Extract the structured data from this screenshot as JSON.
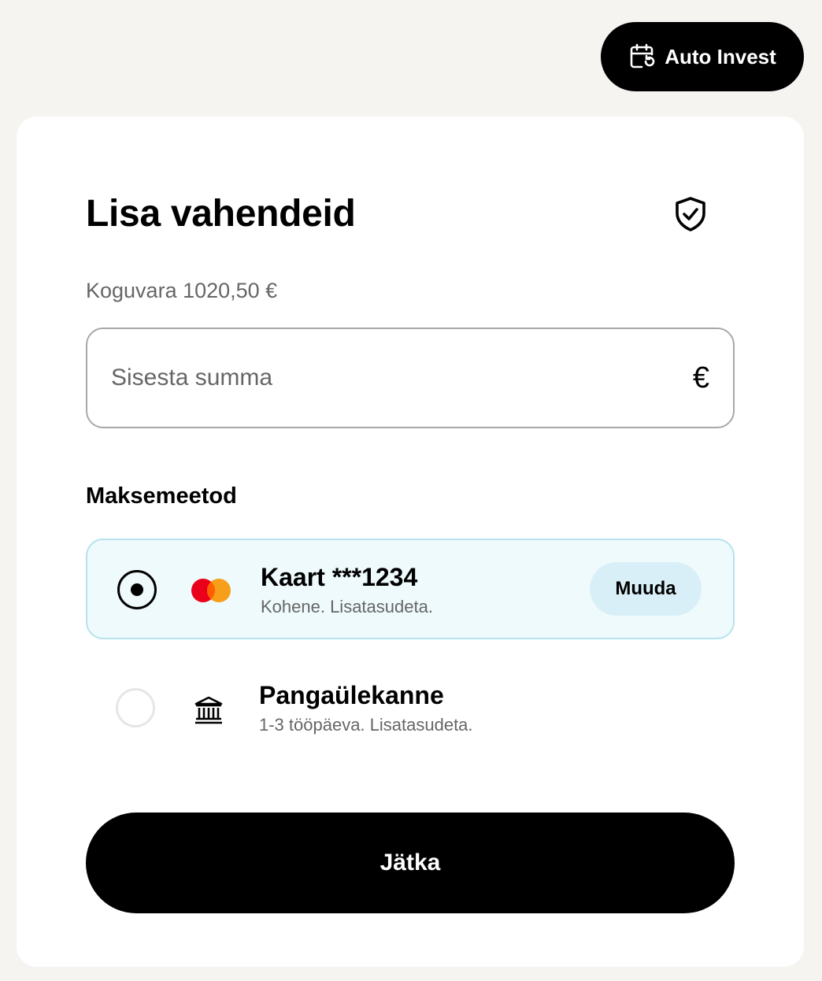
{
  "header": {
    "auto_invest_label": "Auto Invest",
    "auto_invest_icon": "calendar-refresh-icon"
  },
  "card": {
    "title": "Lisa vahendeid",
    "shield_icon": "shield-check-icon",
    "balance_text": "Koguvara 1020,50 €",
    "amount_input": {
      "value": "",
      "placeholder": "Sisesta summa",
      "currency_symbol": "€"
    },
    "payment_section_label": "Maksemeetod",
    "methods": [
      {
        "name": "Kaart ***1234",
        "subtitle": "Kohene. Lisatasudeta.",
        "icon": "mastercard-icon",
        "selected": true,
        "change_label": "Muuda"
      },
      {
        "name": "Pangaülekanne",
        "subtitle": "1-3 tööpäeva. Lisatasudeta.",
        "icon": "bank-icon",
        "selected": false
      }
    ],
    "continue_label": "Jätka"
  },
  "colors": {
    "page_bg": "#f5f4f0",
    "card_bg": "#ffffff",
    "selected_bg": "#eefafc",
    "selected_border": "#b8e2ec",
    "change_btn_bg": "#d9eff7",
    "mastercard_red": "#eb001b",
    "mastercard_orange": "#f79e1b"
  }
}
